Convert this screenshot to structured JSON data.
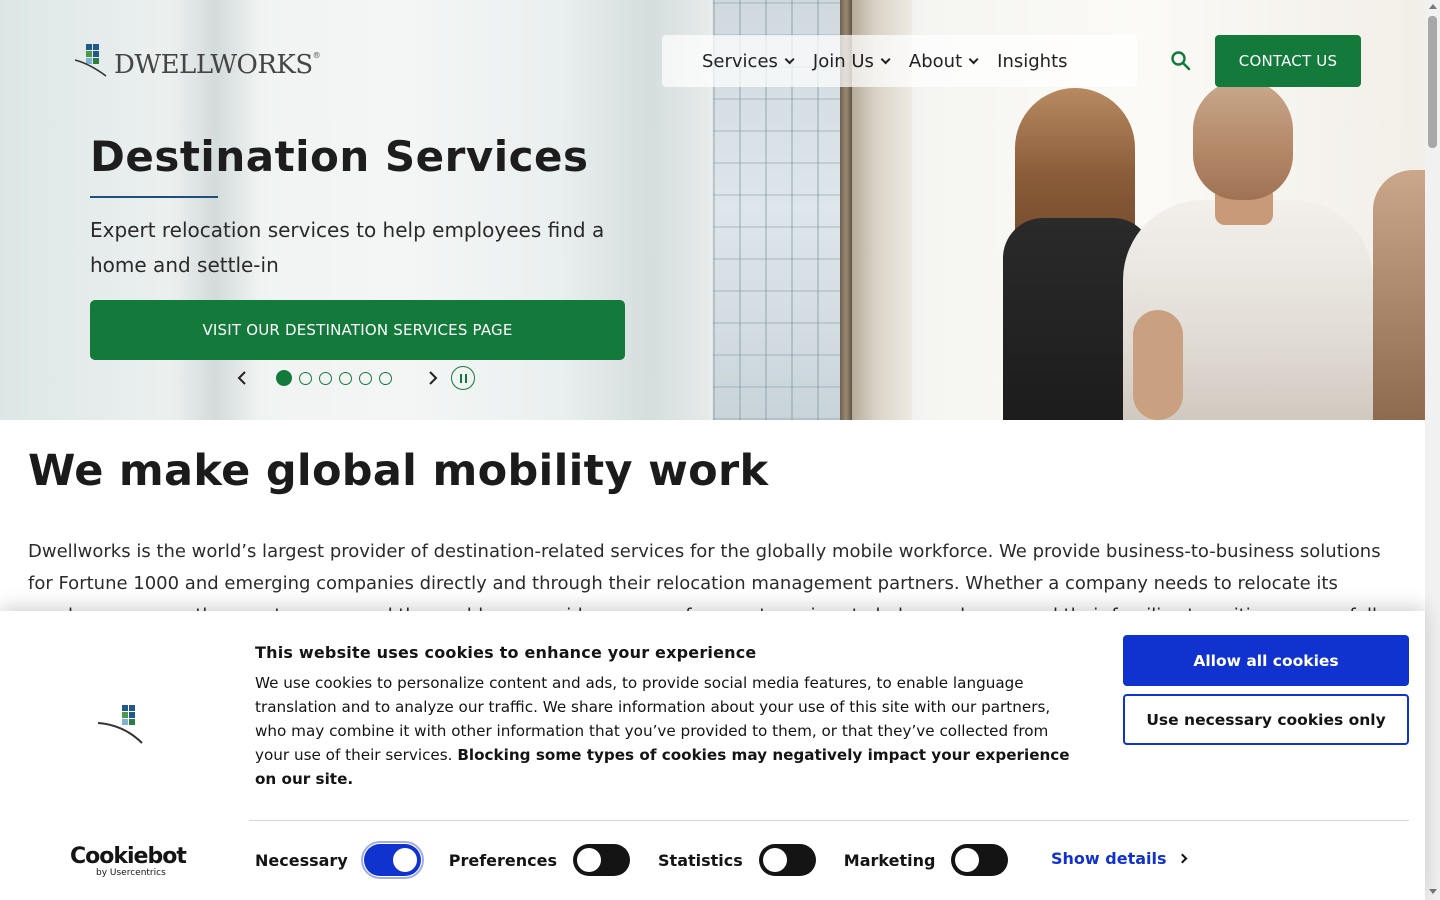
{
  "brand": {
    "logo_text": "DWELLWORKS",
    "logo_mark": "®",
    "accent_color": "#137a3c",
    "cookie_accent_color": "#1032cf"
  },
  "nav": {
    "items": [
      {
        "label": "Services",
        "has_dropdown": true
      },
      {
        "label": "Join Us",
        "has_dropdown": true
      },
      {
        "label": "About",
        "has_dropdown": true
      },
      {
        "label": "Insights",
        "has_dropdown": false
      }
    ],
    "search_icon": "search-icon",
    "contact_label": "CONTACT US"
  },
  "hero": {
    "title": "Destination Services",
    "subtitle": "Expert relocation services to help employees find a home and settle-in",
    "cta_label": "VISIT OUR DESTINATION SERVICES PAGE",
    "carousel": {
      "slide_count": 6,
      "active_slide": 1
    }
  },
  "main": {
    "title": "We make global mobility work",
    "paragraph": "Dwellworks is the world’s largest provider of destination-related services for the globally mobile workforce. We provide business-to-business solutions for Fortune 1000 and emerging companies directly and through their relocation management partners. Whether a company needs to relocate its employees across the country or around the world, we provide a range of support services to help employees and their families transition successfully."
  },
  "cookie_banner": {
    "title": "This website uses cookies to enhance your experience",
    "text_plain": "We use cookies to personalize content and ads, to provide social media features, to enable language translation and to analyze our traffic. We share information about your use of this site with our partners, who may combine it with other information that you’ve provided to them, or that they’ve collected from your use of their services. ",
    "text_bold": "Blocking some types of cookies may negatively impact your experience on our site.",
    "allow_all_label": "Allow all cookies",
    "necessary_only_label": "Use necessary cookies only",
    "brand_name": "Cookiebot",
    "brand_sub": "by Usercentrics",
    "toggles": [
      {
        "label": "Necessary",
        "on": true
      },
      {
        "label": "Preferences",
        "on": false
      },
      {
        "label": "Statistics",
        "on": false
      },
      {
        "label": "Marketing",
        "on": false
      }
    ],
    "show_details_label": "Show details"
  }
}
